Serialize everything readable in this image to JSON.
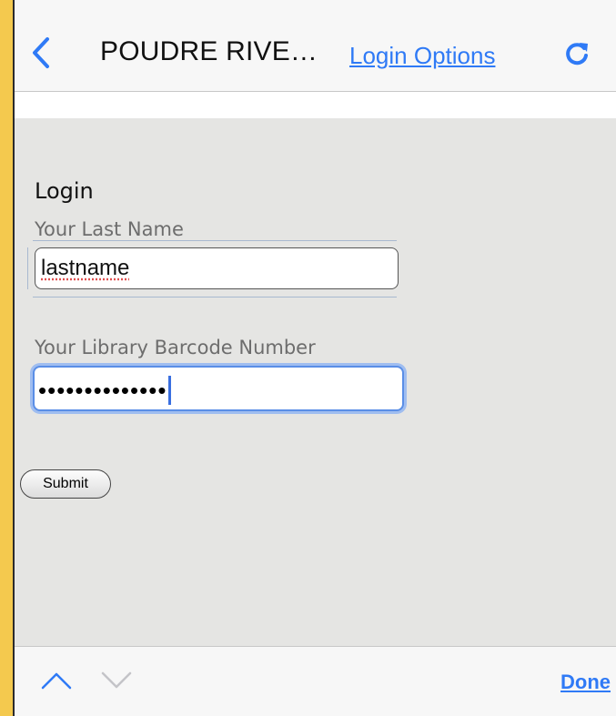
{
  "navbar": {
    "title": "POUDRE RIVE…",
    "link_label": "Login Options",
    "back_icon": "chevron-left-icon",
    "refresh_icon": "refresh-icon",
    "accent_color": "#2f7af6"
  },
  "form": {
    "heading": "Login",
    "last_name_label": "Your Last Name",
    "last_name_value": "lastname",
    "barcode_label": "Your Library Barcode Number",
    "barcode_value_masked": "••••••••••••••",
    "submit_label": "Submit"
  },
  "toolbar": {
    "up_icon": "chevron-up-icon",
    "down_icon": "chevron-down-icon",
    "done_label": "Done"
  }
}
